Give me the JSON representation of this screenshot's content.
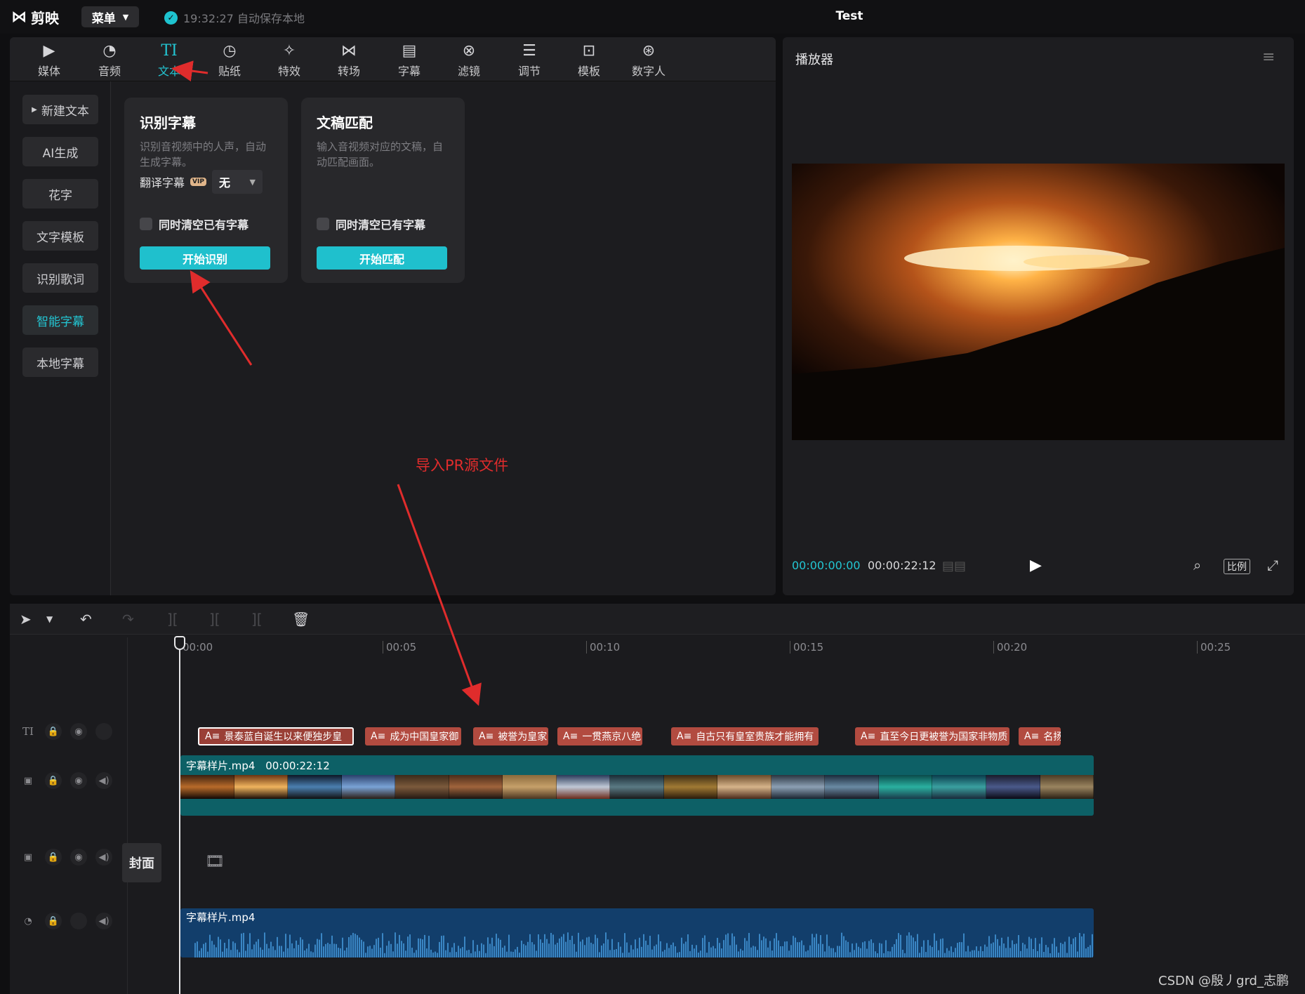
{
  "app": {
    "logo_text": "剪映",
    "menu_label": "菜单",
    "save_status": "19:32:27 自动保存本地",
    "project_title": "Test"
  },
  "toolbar": {
    "tools": [
      {
        "label": "媒体",
        "icon": "media-icon"
      },
      {
        "label": "音频",
        "icon": "audio-icon"
      },
      {
        "label": "文本",
        "icon": "text-icon",
        "active": true
      },
      {
        "label": "贴纸",
        "icon": "sticker-icon"
      },
      {
        "label": "特效",
        "icon": "effects-icon"
      },
      {
        "label": "转场",
        "icon": "transition-icon"
      },
      {
        "label": "字幕",
        "icon": "subtitle-icon"
      },
      {
        "label": "滤镜",
        "icon": "filter-icon"
      },
      {
        "label": "调节",
        "icon": "adjust-icon"
      },
      {
        "label": "模板",
        "icon": "template-icon"
      },
      {
        "label": "数字人",
        "icon": "digital-human-icon"
      }
    ]
  },
  "sidebar": {
    "items": [
      {
        "label": "新建文本"
      },
      {
        "label": "AI生成"
      },
      {
        "label": "花字"
      },
      {
        "label": "文字模板"
      },
      {
        "label": "识别歌词"
      },
      {
        "label": "智能字幕",
        "active": true
      },
      {
        "label": "本地字幕"
      }
    ]
  },
  "cards": {
    "recognize": {
      "title": "识别字幕",
      "desc": "识别音视频中的人声，自动生成字幕。",
      "translate_label": "翻译字幕",
      "vip_badge": "VIP",
      "translate_value": "无",
      "checkbox_label": "同时清空已有字幕",
      "button": "开始识别"
    },
    "match": {
      "title": "文稿匹配",
      "desc": "输入音视频对应的文稿，自动匹配画面。",
      "checkbox_label": "同时清空已有字幕",
      "button": "开始匹配"
    }
  },
  "player": {
    "title": "播放器",
    "current_time": "00:00:00:00",
    "total_time": "00:00:22:12",
    "ratio_label": "比例"
  },
  "timeline": {
    "ruler": [
      "00:00",
      "00:05",
      "00:10",
      "00:15",
      "00:20",
      "00:25"
    ],
    "subtitle_clips": [
      "景泰蓝自诞生以来便独步皇",
      "成为中国皇家御",
      "被誉为皇家",
      "一贯燕京八绝",
      "自古只有皇室贵族才能拥有",
      "直至今日更被誉为国家非物质",
      "名扬"
    ],
    "subtitle_prefix": "A≡",
    "video_clip": {
      "name": "字幕样片.mp4",
      "duration": "00:00:22:12"
    },
    "audio_clip": {
      "name": "字幕样片.mp4"
    },
    "cover_label": "封面"
  },
  "annotations": {
    "note": "导入PR源文件",
    "watermark": "CSDN @殷丿grd_志鹏"
  },
  "colors": {
    "accent": "#23c6d3",
    "subtitle_clip": "#b24b40",
    "video_clip": "#0d6066",
    "audio_clip": "#123e6b",
    "annotation": "#e02c2c"
  }
}
